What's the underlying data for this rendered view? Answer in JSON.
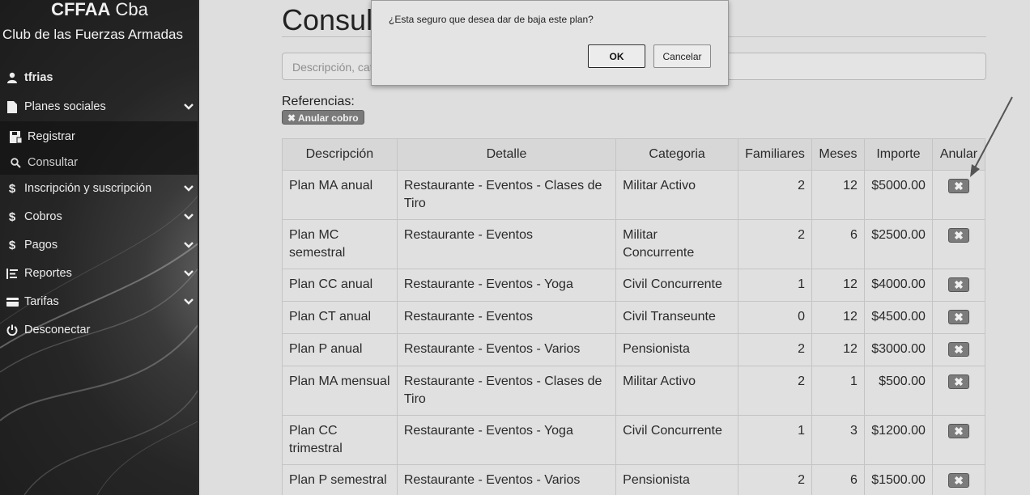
{
  "sidebar": {
    "brand_bold": "CFFAA",
    "brand_rest": " Cba",
    "subtitle": "Club de las Fuerzas Armadas",
    "user": "tfrias",
    "menu": [
      {
        "label": "Planes sociales",
        "icon": "file-icon"
      },
      {
        "label": "Registrar",
        "icon": "save-icon"
      },
      {
        "label": "Consultar",
        "icon": "search-icon"
      },
      {
        "label": "Inscripción y suscripción",
        "icon": "dollar-icon"
      },
      {
        "label": "Cobros",
        "icon": "dollar-icon"
      },
      {
        "label": "Pagos",
        "icon": "dollar-icon"
      },
      {
        "label": "Reportes",
        "icon": "list-icon"
      },
      {
        "label": "Tarifas",
        "icon": "card-icon"
      },
      {
        "label": "Desconectar",
        "icon": "power-icon"
      }
    ]
  },
  "main": {
    "title": "Consul",
    "search_placeholder": "Descripción, cat",
    "references_label": "Referencias:",
    "anular_badge": "Anular cobro",
    "columns": [
      "Descripción",
      "Detalle",
      "Categoria",
      "Familiares",
      "Meses",
      "Importe",
      "Anular"
    ],
    "rows": [
      {
        "descripcion": "Plan MA anual",
        "detalle": "Restaurante - Eventos - Clases de Tiro",
        "categoria": "Militar Activo",
        "familiares": "2",
        "meses": "12",
        "importe": "$5000.00"
      },
      {
        "descripcion": "Plan MC semestral",
        "detalle": "Restaurante - Eventos",
        "categoria": "Militar Concurrente",
        "familiares": "2",
        "meses": "6",
        "importe": "$2500.00"
      },
      {
        "descripcion": "Plan CC anual",
        "detalle": "Restaurante - Eventos - Yoga",
        "categoria": "Civil Concurrente",
        "familiares": "1",
        "meses": "12",
        "importe": "$4000.00"
      },
      {
        "descripcion": "Plan CT anual",
        "detalle": "Restaurante - Eventos",
        "categoria": "Civil Transeunte",
        "familiares": "0",
        "meses": "12",
        "importe": "$4500.00"
      },
      {
        "descripcion": "Plan P anual",
        "detalle": "Restaurante - Eventos - Varios",
        "categoria": "Pensionista",
        "familiares": "2",
        "meses": "12",
        "importe": "$3000.00"
      },
      {
        "descripcion": "Plan MA mensual",
        "detalle": "Restaurante - Eventos - Clases de Tiro",
        "categoria": "Militar Activo",
        "familiares": "2",
        "meses": "1",
        "importe": "$500.00"
      },
      {
        "descripcion": "Plan CC trimestral",
        "detalle": "Restaurante - Eventos - Yoga",
        "categoria": "Civil Concurrente",
        "familiares": "1",
        "meses": "3",
        "importe": "$1200.00"
      },
      {
        "descripcion": "Plan P semestral",
        "detalle": "Restaurante - Eventos - Varios",
        "categoria": "Pensionista",
        "familiares": "2",
        "meses": "6",
        "importe": "$1500.00"
      }
    ]
  },
  "dialog": {
    "message": "¿Esta seguro que desea dar de baja este plan?",
    "ok_label": "OK",
    "cancel_label": "Cancelar"
  }
}
